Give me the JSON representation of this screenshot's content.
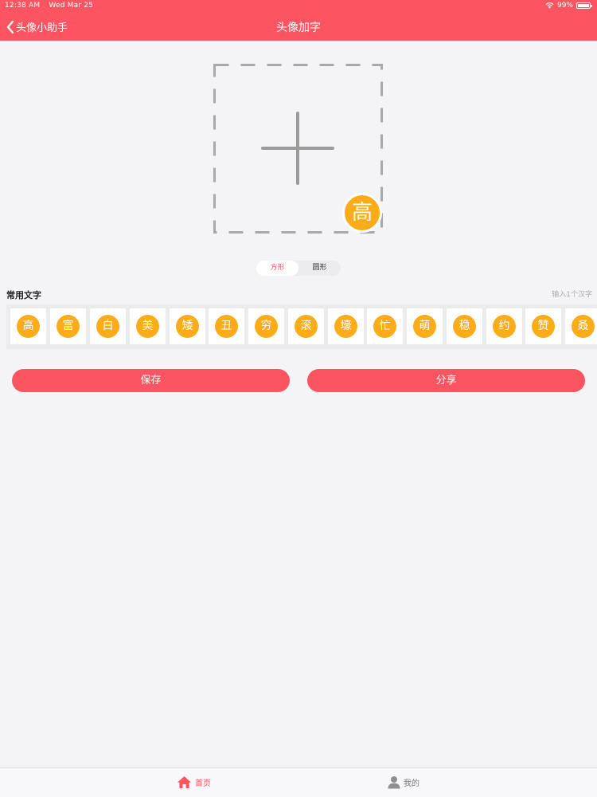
{
  "status_bar": {
    "time": "12:38 AM",
    "date": "Wed Mar 25",
    "battery": "99%",
    "battery_level": 0.99
  },
  "nav": {
    "back_label": "头像小助手",
    "title": "头像加字"
  },
  "preview": {
    "add_icon": "plus-icon",
    "selected_char": "高"
  },
  "shape_toggle": {
    "options": [
      "方形",
      "圆形"
    ],
    "selected": "方形"
  },
  "common_chars": {
    "label": "常用文字",
    "hint": "输入1个汉字",
    "chars": [
      "高",
      "富",
      "白",
      "美",
      "矮",
      "丑",
      "穷",
      "滚",
      "壕",
      "忙",
      "萌",
      "稳",
      "约",
      "赞",
      "叒"
    ]
  },
  "actions": {
    "save_label": "保存",
    "share_label": "分享"
  },
  "tabbar": {
    "home_label": "首页",
    "mine_label": "我的",
    "active": "首页"
  },
  "colors": {
    "accent": "#fd5461",
    "badge": "#fbac18",
    "background": "#f4f4f6"
  }
}
